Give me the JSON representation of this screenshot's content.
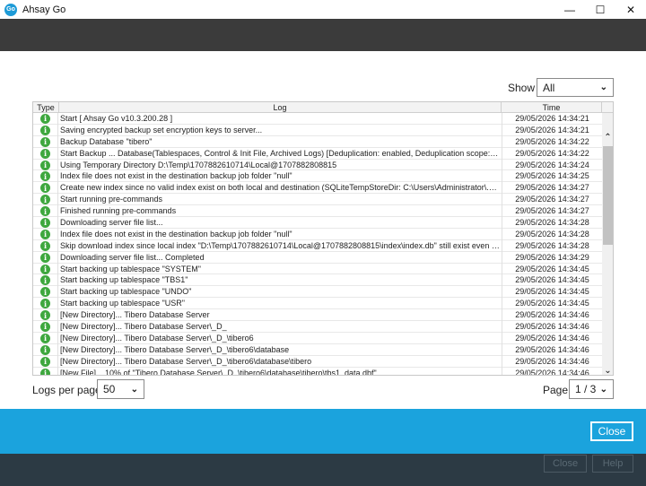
{
  "window": {
    "app_icon_text": "Go",
    "title": "Ahsay Go",
    "minimize": "—",
    "maximize": "☐",
    "close": "✕"
  },
  "filter": {
    "label": "Show",
    "selected": "All"
  },
  "table": {
    "headers": {
      "type": "Type",
      "log": "Log",
      "time": "Time"
    },
    "rows": [
      {
        "log": "Start [ Ahsay Go v10.3.200.28 ]",
        "time": "29/05/2026 14:34:21"
      },
      {
        "log": "Saving encrypted backup set encryption keys to server...",
        "time": "29/05/2026 14:34:21"
      },
      {
        "log": "Backup Database \"tibero\"",
        "time": "29/05/2026 14:34:22"
      },
      {
        "log": "Start Backup ... Database(Tablespaces, Control & Init File, Archived Logs) [Deduplication: enabled, Deduplication scope: Al...",
        "time": "29/05/2026 14:34:22"
      },
      {
        "log": "Using Temporary Directory D:\\Temp\\1707882610714\\Local@1707882808815",
        "time": "29/05/2026 14:34:24"
      },
      {
        "log": "Index file does not exist in the destination backup job folder \"null\"",
        "time": "29/05/2026 14:34:25"
      },
      {
        "log": "Create new index since no valid index exist on both local and destination (SQLiteTempStoreDir: C:\\Users\\Administrator\\.o...",
        "time": "29/05/2026 14:34:27"
      },
      {
        "log": "Start running pre-commands",
        "time": "29/05/2026 14:34:27"
      },
      {
        "log": "Finished running pre-commands",
        "time": "29/05/2026 14:34:27"
      },
      {
        "log": "Downloading server file list...",
        "time": "29/05/2026 14:34:28"
      },
      {
        "log": "Index file does not exist in the destination backup job folder \"null\"",
        "time": "29/05/2026 14:34:28"
      },
      {
        "log": "Skip download index since local index \"D:\\Temp\\1707882610714\\Local@1707882808815\\index\\index.db\" still exist even i...",
        "time": "29/05/2026 14:34:28"
      },
      {
        "log": "Downloading server file list... Completed",
        "time": "29/05/2026 14:34:29"
      },
      {
        "log": "Start backing up tablespace \"SYSTEM\"",
        "time": "29/05/2026 14:34:45"
      },
      {
        "log": "Start backing up tablespace \"TBS1\"",
        "time": "29/05/2026 14:34:45"
      },
      {
        "log": "Start backing up tablespace \"UNDO\"",
        "time": "29/05/2026 14:34:45"
      },
      {
        "log": "Start backing up tablespace \"USR\"",
        "time": "29/05/2026 14:34:45"
      },
      {
        "log": "[New Directory]... Tibero Database Server",
        "time": "29/05/2026 14:34:46"
      },
      {
        "log": "[New Directory]... Tibero Database Server\\_D_",
        "time": "29/05/2026 14:34:46"
      },
      {
        "log": "[New Directory]... Tibero Database Server\\_D_\\tibero6",
        "time": "29/05/2026 14:34:46"
      },
      {
        "log": "[New Directory]... Tibero Database Server\\_D_\\tibero6\\database",
        "time": "29/05/2026 14:34:46"
      },
      {
        "log": "[New Directory]... Tibero Database Server\\_D_\\tibero6\\database\\tibero",
        "time": "29/05/2026 14:34:46"
      },
      {
        "log": "[New File]... 10% of \"Tibero Database Server\\_D_\\tibero6\\database\\tibero\\tbs1_data.dbf\"",
        "time": "29/05/2026 14:34:46"
      }
    ],
    "info_icon": "info-icon",
    "icon_glyph": "i",
    "scroll_up_glyph": "⌃",
    "scroll_down_glyph": "⌄"
  },
  "pagination": {
    "logs_per_page_label": "Logs per page",
    "logs_per_page_value": "50",
    "page_label": "Page",
    "page_value": "1 / 3"
  },
  "footer": {
    "close_label": "Close",
    "bg_close_label": "Close",
    "bg_help_label": "Help"
  },
  "colors": {
    "accent": "#1ba3dd",
    "dark_band": "#3b3b3b",
    "bottom_band": "#2c3a44",
    "info_icon": "#3ea73e"
  }
}
